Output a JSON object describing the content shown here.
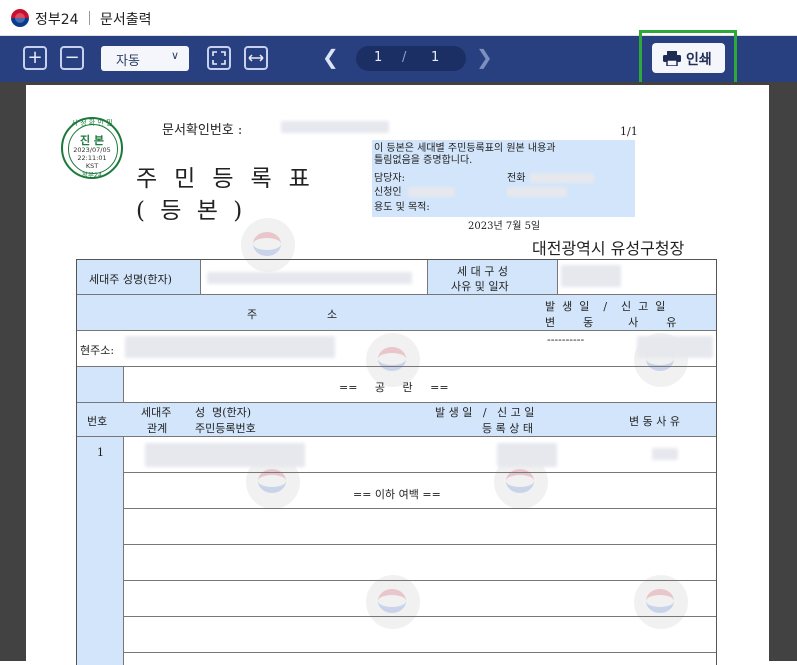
{
  "app": {
    "name": "정부24",
    "doc_title": "문서출력"
  },
  "toolbar": {
    "zoom_in": "+",
    "zoom_out": "−",
    "zoom_value": "자동",
    "page_current": "1",
    "page_sep": "/",
    "page_total": "1",
    "print_label": "인쇄"
  },
  "document": {
    "stamp": {
      "top": "시 정 확 인 필",
      "main": "진 본",
      "date": "2023/07/05",
      "time": "22:11:01",
      "tz": "KST",
      "bottom": "정부24"
    },
    "doc_no_label": "문서확인번호 :",
    "page_indicator": "1/1",
    "title_line1": "주민등록표",
    "title_line2": "( 등   본 )",
    "cert_text_1": "이 등본은 세대별 주민등록표의 원본 내용과",
    "cert_text_2": "틀림없음을 증명합니다.",
    "cert_manager": "담당자:",
    "cert_phone": "전화",
    "cert_applicant": "신청인",
    "cert_purpose": "용도 및 목적:",
    "issue_date": "2023년 7월 5일",
    "issuer": "대전광역시 유성구청장",
    "table": {
      "head_name": "세대주 성명(한자)",
      "head_household_1": "세 대 구 성",
      "head_household_2": "사유 및 일자",
      "addr_col": "주                    소",
      "occur_1": "발  생  일    /    신  고  일",
      "occur_2": "변        동          사        유",
      "current_addr": "현주소:",
      "addr_dashes": "----------",
      "vacant": "==     공     란     ==",
      "col_no": "번호",
      "col_rel_1": "세대주",
      "col_rel_2": "관계",
      "col_name_1": "성  명(한자)",
      "col_name_2": "주민등록번호",
      "col_occur": "발 생 일   /   신 고 일",
      "col_status": "등 록 상 태",
      "col_reason": "변 동 사 유",
      "row_no": "1",
      "end_note": "== 이하 여백 =="
    }
  }
}
